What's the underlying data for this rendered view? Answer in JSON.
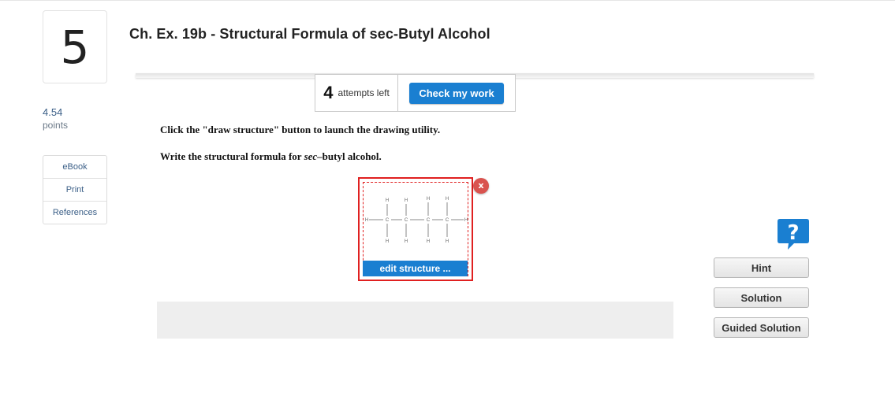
{
  "question": {
    "number": "5",
    "title": "Ch. Ex. 19b - Structural Formula of sec-Butyl Alcohol",
    "points_value": "4.54",
    "points_label": "points"
  },
  "side_links": [
    "eBook",
    "Print",
    "References"
  ],
  "attempts": {
    "count": "4",
    "label": "attempts left",
    "check_button": "Check my work"
  },
  "instructions": {
    "line1": "Click the \"draw structure\" button to launch the drawing utility.",
    "line2_prefix": "Write the structural formula for ",
    "line2_italic": "sec",
    "line2_suffix": "–butyl alcohol."
  },
  "structure_widget": {
    "edit_button": "edit structure ...",
    "close_label": "x",
    "atom_h": "H",
    "atom_c": "C"
  },
  "help": {
    "icon": "question-mark-icon",
    "glyph": "?",
    "buttons": [
      "Hint",
      "Solution",
      "Guided Solution"
    ]
  },
  "colors": {
    "primary_button": "#1a7fd1",
    "close_button": "#d9534f",
    "highlight_border": "#e02020",
    "help_icon": "#1a7fd1"
  }
}
